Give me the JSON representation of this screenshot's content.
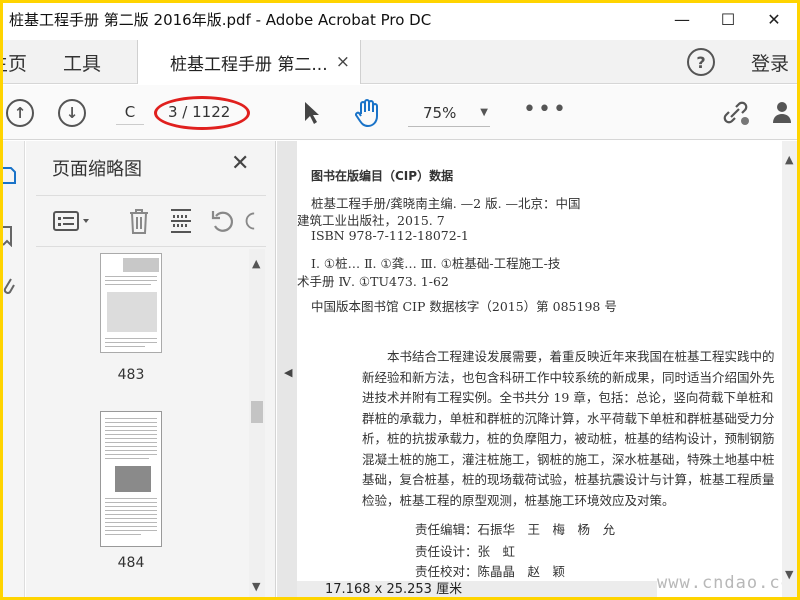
{
  "window": {
    "title": "桩基工程手册 第二版 2016年版.pdf - Adobe Acrobat Pro DC",
    "minimize": "—",
    "maximize": "☐",
    "close": "✕"
  },
  "tabs": {
    "home": "主页",
    "tools": "工具",
    "document": "桩基工程手册 第二...",
    "document_close": "×",
    "help": "?",
    "login": "登录"
  },
  "toolbar": {
    "prev_page_icon": "arrow-up-circle",
    "next_page_icon": "arrow-down-circle",
    "current_page": "C",
    "page_count": "3 / 1122",
    "zoom": "75%",
    "more": "•••",
    "highlight_color": "#e0201e"
  },
  "thumbnail_panel": {
    "title": "页面缩略图",
    "close": "✕",
    "thumbnails": [
      {
        "label": "483"
      },
      {
        "label": "484"
      }
    ]
  },
  "document": {
    "cip_heading": "图书在版编目（CIP）数据",
    "cip_lines": [
      "桩基工程手册/龚晓南主编. —2 版. —北京：中国",
      "建筑工业出版社，2015. 7",
      "ISBN 978-7-112-18072-1",
      "Ⅰ. ①桩… Ⅱ. ①龚… Ⅲ. ①桩基础-工程施工-技",
      "术手册 Ⅳ. ①TU473. 1-62"
    ],
    "cip_number": "中国版本图书馆 CIP 数据核字（2015）第 085198 号",
    "summary": "本书结合工程建设发展需要，着重反映近年来我国在桩基工程实践中的新经验和新方法，也包含科研工作中较系统的新成果，同时适当介绍国外先进技术并附有工程实例。全书共分 19 章，包括：总论，竖向荷载下单桩和群桩的承载力，单桩和群桩的沉降计算，水平荷载下单桩和群桩基础受力分析，桩的抗拔承载力，桩的负摩阻力，被动桩，桩基的结构设计，预制钢筋混凝土桩的施工，灌注桩施工，钢桩的施工，深水桩基础，特殊土地基中桩基础，复合桩基，桩的现场载荷试验，桩基抗震设计与计算，桩基工程质量检验，桩基工程的原型观测，桩基施工环境效应及对策。",
    "editors": [
      "责任编辑：石振华　王　梅　杨　允",
      "责任设计：张　虹",
      "责任校对：陈晶晶　赵　颖"
    ]
  },
  "status": {
    "page_size": "17.168 x 25.253 厘米"
  },
  "watermark": "www.cndao.com"
}
